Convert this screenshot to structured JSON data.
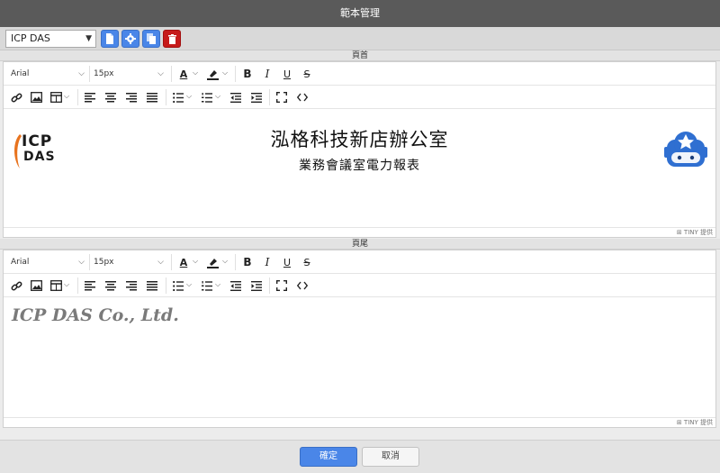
{
  "window": {
    "title": "範本管理"
  },
  "template_selector": {
    "value": "ICP DAS"
  },
  "toolbar_icons": [
    "new-document-icon",
    "gear-icon",
    "copy-icon",
    "trash-icon"
  ],
  "header_section": {
    "label": "頁首"
  },
  "footer_section": {
    "label": "頁尾"
  },
  "editor_toolbar": {
    "font_family": "Arial",
    "font_size": "15px",
    "text_color_icon": "A",
    "bold_icon": "B",
    "italic_icon": "I",
    "underline_icon": "U",
    "strike_icon": "S"
  },
  "header_content": {
    "logo_line1": "ICP",
    "logo_line2": "DAS",
    "title": "泓格科技新店辦公室",
    "subtitle": "業務會議室電力報表"
  },
  "footer_content": {
    "text": "ICP DAS Co., Ltd."
  },
  "status_bar": {
    "text": "⊞ TINY 提供"
  },
  "buttons": {
    "ok": "確定",
    "cancel": "取消"
  },
  "colors": {
    "primary": "#4a86e8",
    "danger": "#c61a1a",
    "logo_orange": "#e8731e",
    "robot_blue": "#2f6fd1"
  }
}
